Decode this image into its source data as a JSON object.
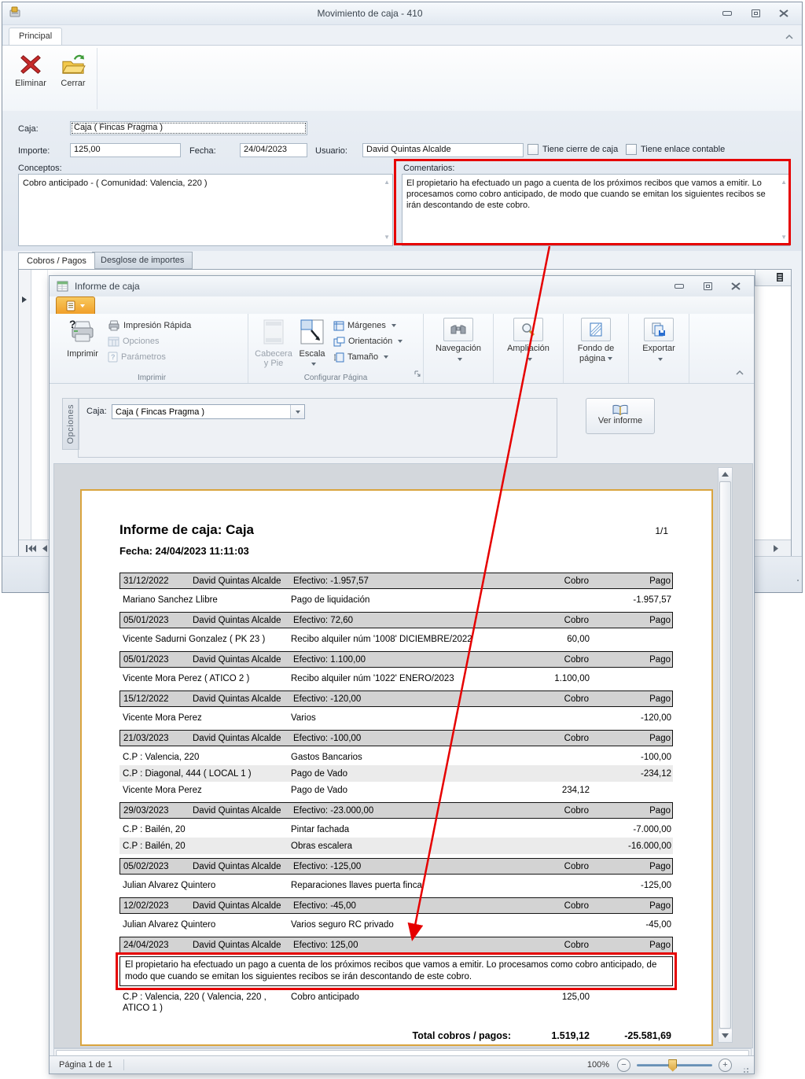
{
  "colors": {
    "annotation_red": "#e60000",
    "page_border_gold": "#d9a43e",
    "app_button_orange": "#f09d27",
    "group_header_gray": "#d3d3d3"
  },
  "outer": {
    "title": "Movimiento de caja - 410",
    "tab_principal": "Principal",
    "btn_eliminar": "Eliminar",
    "btn_cerrar": "Cerrar",
    "labels": {
      "caja": "Caja:",
      "importe": "Importe:",
      "fecha": "Fecha:",
      "usuario": "Usuario:",
      "conceptos": "Conceptos:",
      "comentarios": "Comentarios:"
    },
    "values": {
      "caja": "Caja ( Fincas Pragma )",
      "importe": "125,00",
      "fecha": "24/04/2023",
      "usuario": "David Quintas Alcalde",
      "conceptos": "Cobro anticipado -  ( Comunidad: Valencia, 220 )",
      "comentarios": "El propietario ha efectuado un pago a cuenta de los próximos recibos que vamos a emitir. Lo procesamos como cobro anticipado, de modo que cuando se emitan los siguientes recibos se irán descontando de este cobro."
    },
    "checkbox_cierre": "Tiene cierre de caja",
    "checkbox_enlace": "Tiene enlace contable",
    "tab_cobros": "Cobros / Pagos",
    "tab_desglose": "Desglose de importes"
  },
  "informe": {
    "title": "Informe de caja",
    "ribbon": {
      "imprimir": "Imprimir",
      "impresion_rapida": "Impresión Rápida",
      "opciones": "Opciones",
      "parametros": "Parámetros",
      "grp_imprimir": "Imprimir",
      "cabecera_pie": "Cabecera y Pie",
      "escala": "Escala",
      "margenes": "Márgenes",
      "orientacion": "Orientación",
      "tamano": "Tamaño",
      "grp_configurar": "Configurar Página",
      "navegacion": "Navegación",
      "ampliacion": "Ampliación",
      "fondo_pagina": "Fondo de página",
      "exportar": "Exportar"
    },
    "options_panel": {
      "tab": "Opciones",
      "caja_label": "Caja:",
      "caja_value": "Caja ( Fincas Pragma )",
      "ver_informe": "Ver informe"
    },
    "statusbar": {
      "page": "Página 1 de 1",
      "zoom": "100%"
    }
  },
  "report": {
    "title": "Informe de caja: Caja",
    "page_indicator": "1/1",
    "fecha": "Fecha: 24/04/2023 11:11:03",
    "col_cobro": "Cobro",
    "col_pago": "Pago",
    "groups": [
      {
        "date": "31/12/2022",
        "user": "David Quintas Alcalde",
        "efectivo": "Efectivo: -1.957,57",
        "rows": [
          {
            "name": "Mariano Sanchez Llibre",
            "concept": "Pago de liquidación",
            "cobro": "",
            "pago": "-1.957,57"
          }
        ]
      },
      {
        "date": "05/01/2023",
        "user": "David Quintas Alcalde",
        "efectivo": "Efectivo: 72,60",
        "rows": [
          {
            "name": "Vicente Sadurni Gonzalez ( PK 23 )",
            "concept": "Recibo alquiler núm '1008' DICIEMBRE/2022",
            "cobro": "60,00",
            "pago": ""
          }
        ]
      },
      {
        "date": "05/01/2023",
        "user": "David Quintas Alcalde",
        "efectivo": "Efectivo: 1.100,00",
        "rows": [
          {
            "name": "Vicente Mora Perez ( ATICO 2 )",
            "concept": "Recibo alquiler núm '1022' ENERO/2023",
            "cobro": "1.100,00",
            "pago": ""
          }
        ]
      },
      {
        "date": "15/12/2022",
        "user": "David Quintas Alcalde",
        "efectivo": "Efectivo: -120,00",
        "rows": [
          {
            "name": "Vicente Mora Perez",
            "concept": "Varios",
            "cobro": "",
            "pago": "-120,00"
          }
        ]
      },
      {
        "date": "21/03/2023",
        "user": "David Quintas Alcalde",
        "efectivo": "Efectivo: -100,00",
        "rows": [
          {
            "name": "C.P : Valencia, 220",
            "concept": "Gastos Bancarios",
            "cobro": "",
            "pago": "-100,00"
          },
          {
            "name": "C.P : Diagonal, 444 ( LOCAL 1 )",
            "concept": "Pago de Vado",
            "cobro": "",
            "pago": "-234,12",
            "alt": true
          },
          {
            "name": "Vicente Mora Perez",
            "concept": "Pago de Vado",
            "cobro": "234,12",
            "pago": ""
          }
        ]
      },
      {
        "date": "29/03/2023",
        "user": "David Quintas Alcalde",
        "efectivo": "Efectivo: -23.000,00",
        "rows": [
          {
            "name": "C.P : Bailén, 20",
            "concept": "Pintar fachada",
            "cobro": "",
            "pago": "-7.000,00"
          },
          {
            "name": "C.P : Bailén, 20",
            "concept": "Obras escalera",
            "cobro": "",
            "pago": "-16.000,00",
            "alt": true
          }
        ]
      },
      {
        "date": "05/02/2023",
        "user": "David Quintas Alcalde",
        "efectivo": "Efectivo: -125,00",
        "rows": [
          {
            "name": "Julian Alvarez Quintero",
            "concept": "Reparaciones llaves puerta finca",
            "cobro": "",
            "pago": "-125,00"
          }
        ]
      },
      {
        "date": "12/02/2023",
        "user": "David Quintas Alcalde",
        "efectivo": "Efectivo: -45,00",
        "rows": [
          {
            "name": "Julian Alvarez Quintero",
            "concept": "Varios seguro RC privado",
            "cobro": "",
            "pago": "-45,00"
          }
        ]
      },
      {
        "date": "24/04/2023",
        "user": "David Quintas Alcalde",
        "efectivo": "Efectivo: 125,00",
        "comment": "El propietario ha efectuado un pago a cuenta de los próximos recibos que vamos a emitir. Lo procesamos como cobro anticipado, de modo que cuando se emitan los siguientes recibos se irán descontando de este cobro.",
        "rows": [
          {
            "name": "C.P : Valencia, 220 ( Valencia, 220 , ATICO 1 )",
            "concept": "Cobro anticipado",
            "cobro": "125,00",
            "pago": ""
          }
        ]
      }
    ],
    "total_label": "Total cobros / pagos:",
    "total_cobro": "1.519,12",
    "total_pago": "-25.581,69"
  }
}
